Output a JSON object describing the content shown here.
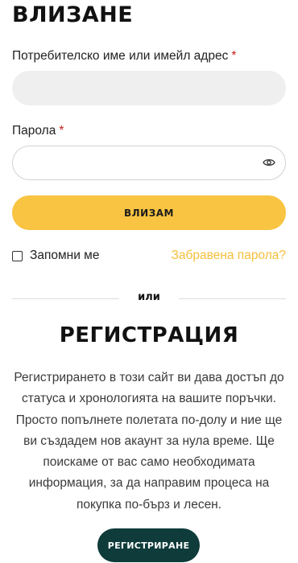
{
  "login": {
    "title": "ВЛИЗАНЕ",
    "username_label": "Потребителско име или имейл адрес",
    "password_label": "Парола",
    "required_mark": "*",
    "username_value": "",
    "password_value": "",
    "submit_label": "ВЛИЗАМ",
    "remember_label": "Запомни ме",
    "remember_checked": false,
    "forgot_label": "Забравена парола?"
  },
  "divider": {
    "text": "или"
  },
  "register": {
    "title": "РЕГИСТРАЦИЯ",
    "description": "Регистрирането в този сайт ви дава достъп до статуса и хронологията на вашите поръчки. Просто попълнете полетата по-долу и ние ще ви създадем нов акаунт за нула време. Ще поискаме от вас само необходимата информация, за да направим процеса на покупка по-бърз и лесен.",
    "button_label": "РЕГИСТРИРАНЕ"
  },
  "icons": {
    "password_toggle": "eye-icon"
  },
  "colors": {
    "primary_button": "#f8c441",
    "link": "#f6bf3c",
    "register_button": "#0f3b3a",
    "required": "#c81e1e"
  }
}
